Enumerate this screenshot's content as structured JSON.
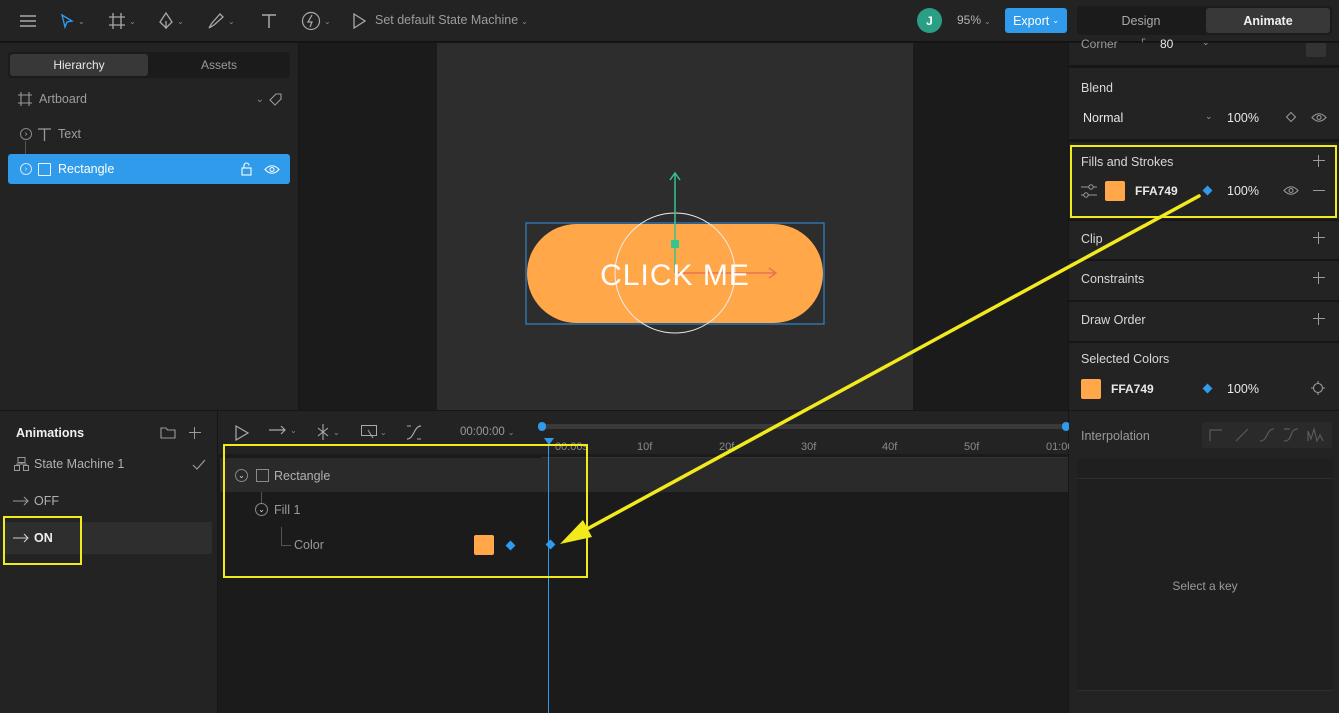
{
  "toolbar": {
    "state_machine_label": "Set default State Machine",
    "avatar_initial": "J",
    "zoom": "95%",
    "export_label": "Export",
    "mode_design": "Design",
    "mode_animate": "Animate"
  },
  "hierarchy": {
    "tabs": [
      "Hierarchy",
      "Assets"
    ],
    "items": [
      {
        "label": "Artboard"
      },
      {
        "label": "Text"
      },
      {
        "label": "Rectangle"
      }
    ]
  },
  "stage": {
    "button_text": "CLICK ME",
    "button_color": "#ffa749"
  },
  "inspector": {
    "corner_label": "Corner",
    "corner_value": "80",
    "blend": {
      "title": "Blend",
      "mode": "Normal",
      "opacity": "100%"
    },
    "fills": {
      "title": "Fills and Strokes",
      "hex": "FFA749",
      "opacity": "100%"
    },
    "clip_title": "Clip",
    "constraints_title": "Constraints",
    "draw_order_title": "Draw Order",
    "selected_colors": {
      "title": "Selected Colors",
      "hex": "FFA749",
      "opacity": "100%"
    }
  },
  "animations": {
    "title": "Animations",
    "items": [
      {
        "label": "State Machine 1"
      },
      {
        "label": "OFF"
      },
      {
        "label": "ON"
      }
    ]
  },
  "timeline": {
    "time": "00:00:00",
    "ruler": [
      "00:00s",
      "10f",
      "20f",
      "30f",
      "40f",
      "50f",
      "01:00"
    ],
    "tracks": [
      {
        "label": "Rectangle"
      },
      {
        "label": "Fill 1"
      },
      {
        "label": "Color"
      }
    ]
  },
  "interpolation": {
    "title": "Interpolation",
    "empty_text": "Select a key"
  },
  "colors": {
    "accent": "#2f9bea",
    "fill": "#ffa749",
    "annotation": "#f2ea1c"
  }
}
